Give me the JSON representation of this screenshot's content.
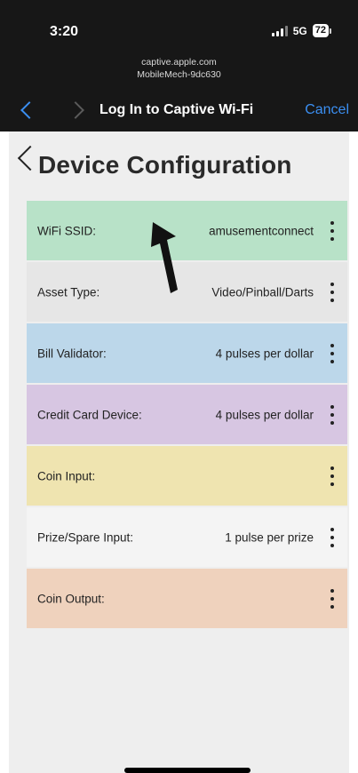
{
  "status_bar": {
    "time": "3:20",
    "network": "5G",
    "battery": "72"
  },
  "browser": {
    "domain": "captive.apple.com",
    "subtitle": "MobileMech-9dc630",
    "title": "Log In to Captive Wi-Fi",
    "cancel_label": "Cancel"
  },
  "page": {
    "title": "Device Configuration"
  },
  "config_rows": [
    {
      "label": "WiFi SSID:",
      "value": "amusementconnect",
      "color": "#b8e2c8"
    },
    {
      "label": "Asset Type:",
      "value": "Video/Pinball/Darts",
      "color": "#e6e6e6"
    },
    {
      "label": "Bill Validator:",
      "value": "4 pulses per dollar",
      "color": "#bcd7ea"
    },
    {
      "label": "Credit Card Device:",
      "value": "4 pulses per dollar",
      "color": "#d7c6e2"
    },
    {
      "label": "Coin Input:",
      "value": "",
      "color": "#efe4b0"
    },
    {
      "label": "Prize/Spare Input:",
      "value": "1 pulse per prize",
      "color": "#f4f4f4"
    },
    {
      "label": "Coin Output:",
      "value": "",
      "color": "#efd2bd"
    }
  ],
  "colors": {
    "accent_blue": "#3b8ff2",
    "top_bar": "#171717",
    "page_background": "#eeeeee"
  },
  "icons": {
    "back": "chevron-left-icon",
    "forward": "chevron-right-icon",
    "row_menu": "more-vertical-icon",
    "annotation": "arrow-up-icon"
  }
}
